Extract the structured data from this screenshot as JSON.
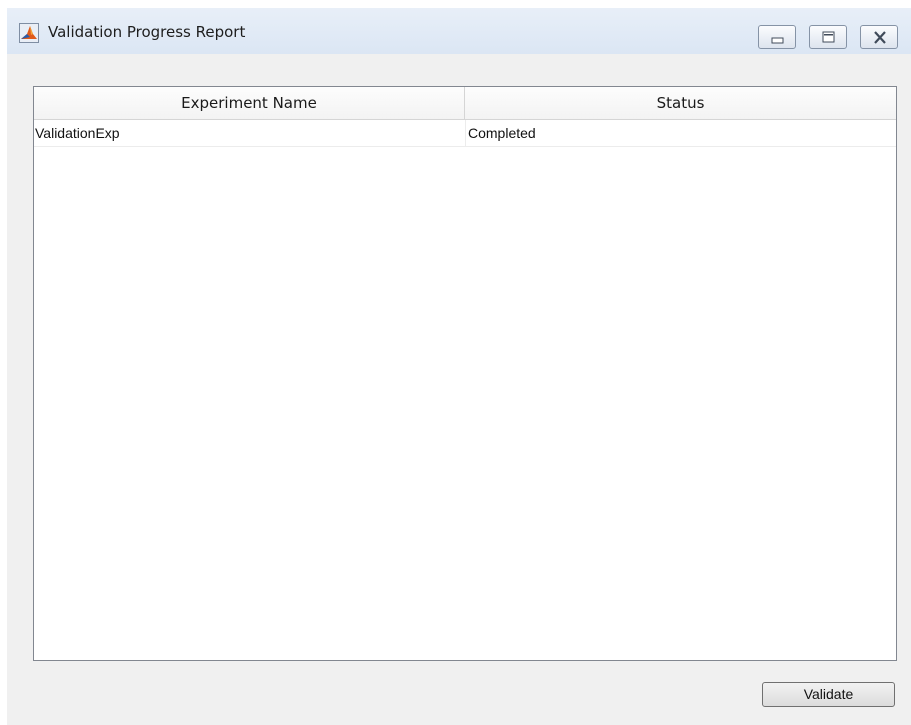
{
  "window": {
    "title": "Validation Progress Report",
    "icon": "matlab-logo-icon",
    "controls": [
      "minimize-icon",
      "maximize-icon",
      "close-icon"
    ]
  },
  "table": {
    "columns": [
      "Experiment Name",
      "Status"
    ],
    "rows": [
      [
        "ValidationExp",
        "Completed"
      ]
    ]
  },
  "actions": {
    "validate_label": "Validate"
  },
  "colors": {
    "titlebar": "#dbe6f4",
    "window_bg": "#f0f0f0",
    "table_border": "#828790"
  }
}
